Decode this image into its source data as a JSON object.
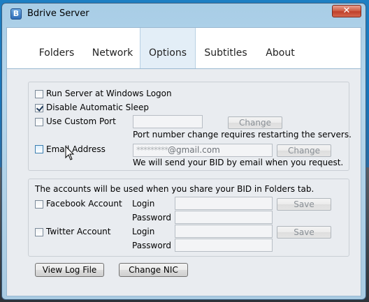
{
  "window": {
    "title": "Bdrive Server",
    "close_glyph": "✕",
    "app_icon_letter": "B"
  },
  "tabs": [
    {
      "label": "Folders"
    },
    {
      "label": "Network"
    },
    {
      "label": "Options",
      "active": true
    },
    {
      "label": "Subtitles"
    },
    {
      "label": "About"
    }
  ],
  "options": {
    "run_server": {
      "label": "Run Server at Windows Logon",
      "checked": false
    },
    "disable_sleep": {
      "label": "Disable Automatic Sleep",
      "checked": true
    },
    "custom_port": {
      "label": "Use Custom Port",
      "checked": false,
      "value": "",
      "change_label": "Change",
      "note": "Port number change requires restarting the servers."
    },
    "email": {
      "label": "Email Address",
      "checked": false,
      "value_masked": "*********",
      "value_domain": "@gmail.com",
      "change_label": "Change",
      "note": "We will send your BID by email when you request."
    }
  },
  "accounts": {
    "intro": "The accounts will be used when you share your BID in Folders tab.",
    "facebook": {
      "label": "Facebook Account",
      "checked": false,
      "login_label": "Login",
      "password_label": "Password",
      "save_label": "Save"
    },
    "twitter": {
      "label": "Twitter Account",
      "checked": false,
      "login_label": "Login",
      "password_label": "Password",
      "save_label": "Save"
    }
  },
  "footer": {
    "view_log_label": "View Log File",
    "change_nic_label": "Change NIC"
  }
}
